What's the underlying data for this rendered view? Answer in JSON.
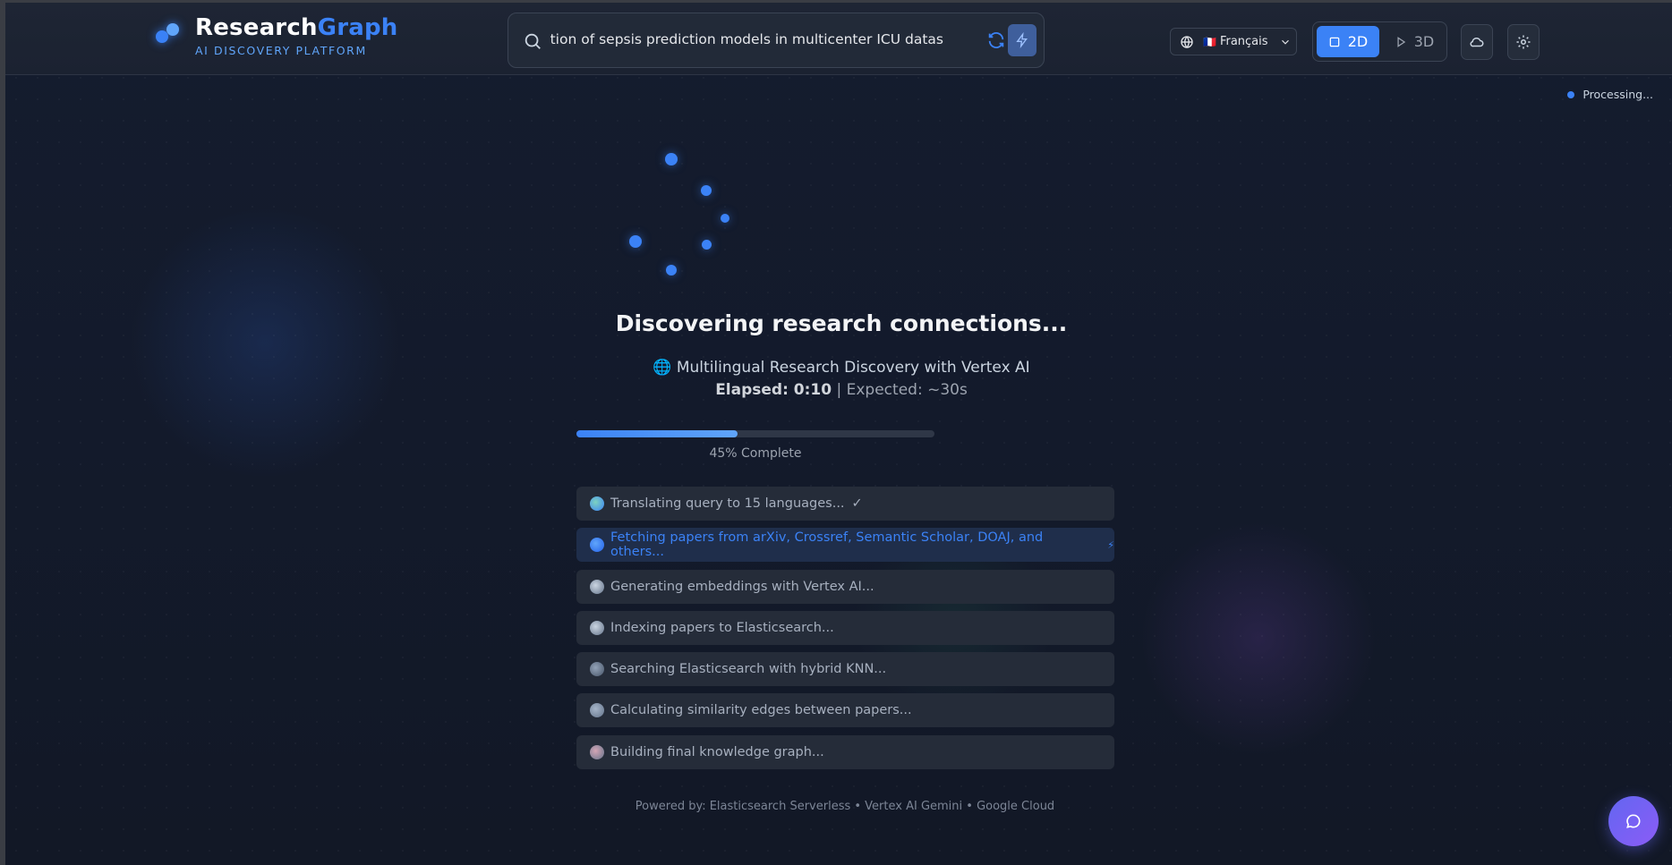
{
  "header": {
    "brand_part1": "Research",
    "brand_part2": "Graph",
    "brand_subtitle": "AI DISCOVERY PLATFORM",
    "search_value": "ernal validation of sepsis prediction models in multicenter ICU datas",
    "language": {
      "flag": "🇫🇷",
      "label": "Français"
    },
    "view_toggle": {
      "option_2d": "2D",
      "option_3d": "3D",
      "selected": "2D"
    }
  },
  "status": {
    "processing_label": "Processing..."
  },
  "main": {
    "title": "Discovering research connections...",
    "subtitle": "🌐 Multilingual Research Discovery with Vertex AI",
    "elapsed_label": "Elapsed: 0:10",
    "expected_label": "| Expected: ~30s",
    "progress_percent": 45,
    "progress_label": "45% Complete",
    "steps": [
      {
        "label": "Translating query to 15 languages...",
        "suffix": "✓",
        "icon": "globe-icon",
        "state": "done"
      },
      {
        "label": "Fetching papers from arXiv, Crossref, Semantic Scholar, DOAJ, and others...",
        "suffix": "⚡",
        "icon": "search-icon",
        "state": "active"
      },
      {
        "label": "Generating embeddings with Vertex AI...",
        "suffix": "",
        "icon": "database-icon",
        "state": "pending"
      },
      {
        "label": "Indexing papers to Elasticsearch...",
        "suffix": "",
        "icon": "database-icon",
        "state": "pending"
      },
      {
        "label": "Searching Elasticsearch with hybrid KNN...",
        "suffix": "",
        "icon": "hybrid-search-icon",
        "state": "pending"
      },
      {
        "label": "Calculating similarity edges between papers...",
        "suffix": "",
        "icon": "network-icon",
        "state": "pending"
      },
      {
        "label": "Building final knowledge graph...",
        "suffix": "",
        "icon": "brain-icon",
        "state": "pending"
      }
    ],
    "footer": "Powered by: Elasticsearch Serverless • Vertex AI Gemini • Google Cloud"
  },
  "colors": {
    "accent": "#3b82f6",
    "background": "#131a2b",
    "chat_gradient_start": "#6366f1",
    "chat_gradient_end": "#8b5cf6"
  }
}
